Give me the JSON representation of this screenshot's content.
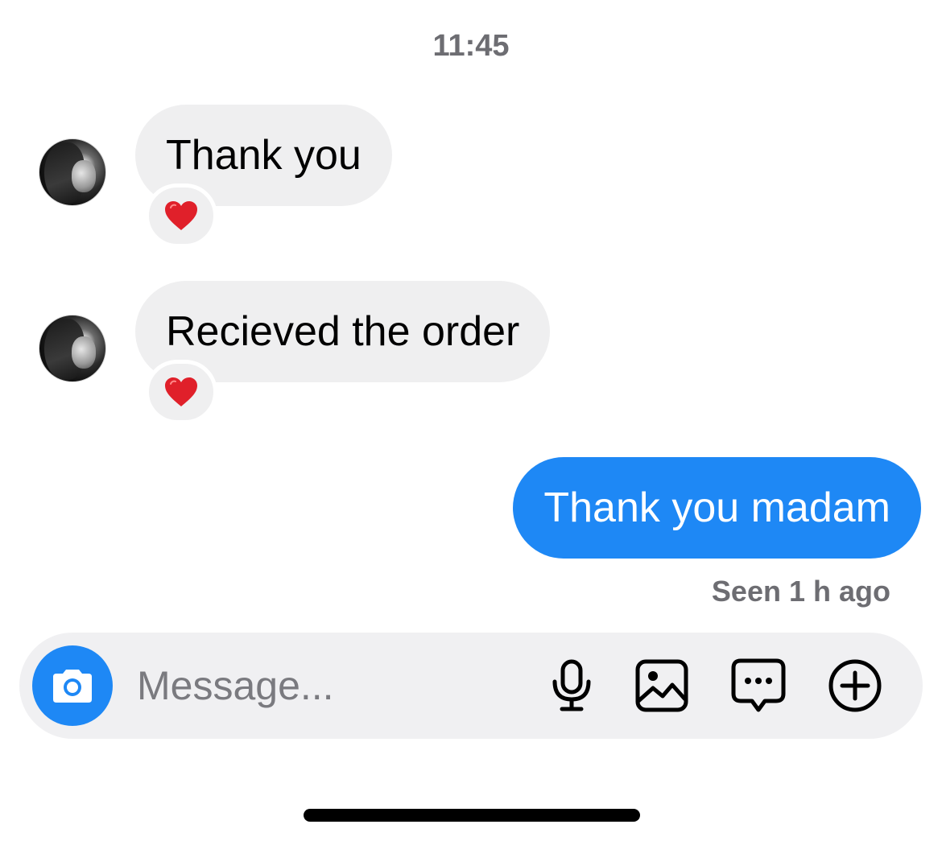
{
  "header": {
    "time": "11:45"
  },
  "messages": [
    {
      "from": "other",
      "text": "Thank you",
      "reaction": "heart-icon"
    },
    {
      "from": "other",
      "text": "Recieved the order",
      "reaction": "heart-icon"
    },
    {
      "from": "me",
      "text": "Thank you madam"
    }
  ],
  "status": {
    "seen": "Seen 1 h ago"
  },
  "composer": {
    "placeholder": "Message...",
    "icons": [
      "camera-icon",
      "microphone-icon",
      "gallery-icon",
      "sticker-icon",
      "add-icon"
    ]
  },
  "colors": {
    "outgoing_bubble": "#1e88f5",
    "incoming_bubble": "#efeff0",
    "heart": "#e0202a"
  }
}
